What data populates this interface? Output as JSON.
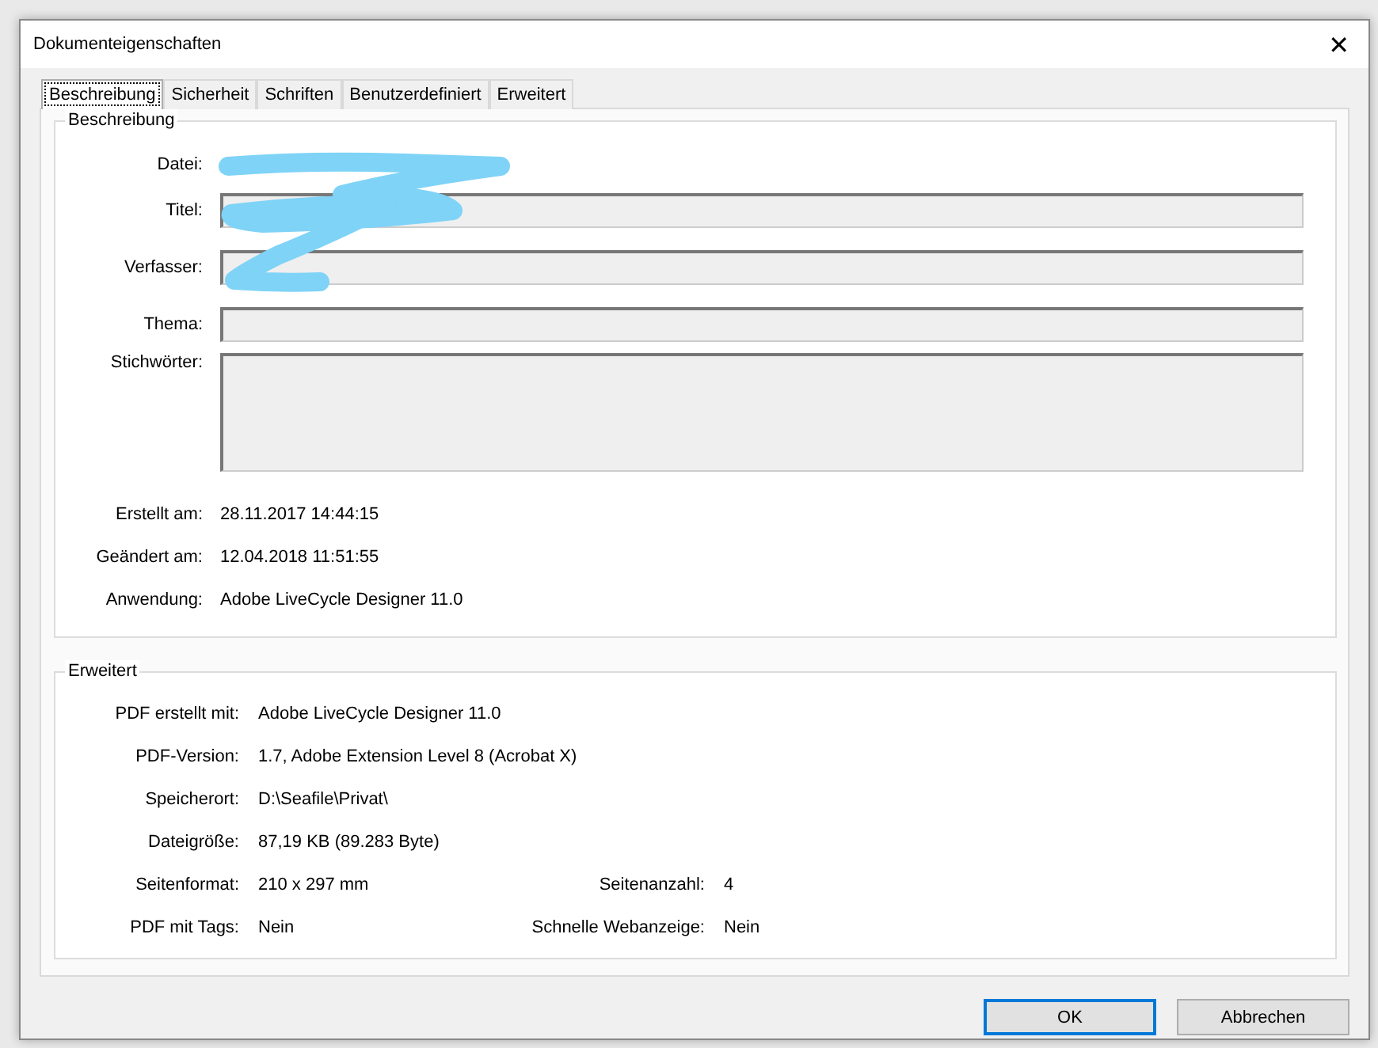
{
  "window": {
    "title": "Dokumenteigenschaften",
    "close": "✕"
  },
  "tabs": [
    {
      "label": "Beschreibung",
      "selected": true
    },
    {
      "label": "Sicherheit",
      "selected": false
    },
    {
      "label": "Schriften",
      "selected": false
    },
    {
      "label": "Benutzerdefiniert",
      "selected": false
    },
    {
      "label": "Erweitert",
      "selected": false
    }
  ],
  "description": {
    "title": "Beschreibung",
    "rows": [
      {
        "kind": "text",
        "label": "Datei:"
      },
      {
        "kind": "line",
        "label": "Titel:"
      },
      {
        "kind": "line",
        "label": "Verfasser:"
      },
      {
        "kind": "line",
        "label": "Thema:"
      },
      {
        "kind": "area",
        "label": "Stichwörter:"
      },
      {
        "kind": "text",
        "label": "Erstellt am:",
        "value": "28.11.2017 14:44:15"
      },
      {
        "kind": "text",
        "label": "Geändert am:",
        "value": "12.04.2018 11:51:55"
      },
      {
        "kind": "text",
        "label": "Anwendung:",
        "value": "Adobe LiveCycle Designer 11.0"
      }
    ]
  },
  "advanced": {
    "title": "Erweitert",
    "rows": [
      [
        {
          "label": "PDF erstellt mit:",
          "value": "Adobe LiveCycle Designer 11.0"
        }
      ],
      [
        {
          "label": "PDF-Version:",
          "value": "1.7, Adobe Extension Level 8 (Acrobat X)"
        }
      ],
      [
        {
          "label": "Speicherort:",
          "value": "D:\\Seafile\\Privat\\"
        }
      ],
      [
        {
          "label": "Dateigröße:",
          "value": "87,19 KB (89.283 Byte)"
        }
      ],
      [
        {
          "label": "Seitenformat:",
          "value": "210 x 297 mm"
        },
        {
          "label": "Seitenanzahl:",
          "value": "4"
        }
      ],
      [
        {
          "label": "PDF mit Tags:",
          "value": "Nein"
        },
        {
          "label": "Schnelle Webanzeige:",
          "value": "Nein"
        }
      ]
    ]
  },
  "buttons": [
    {
      "label": "OK",
      "default": true
    },
    {
      "label": "Abbrechen",
      "default": false
    }
  ]
}
